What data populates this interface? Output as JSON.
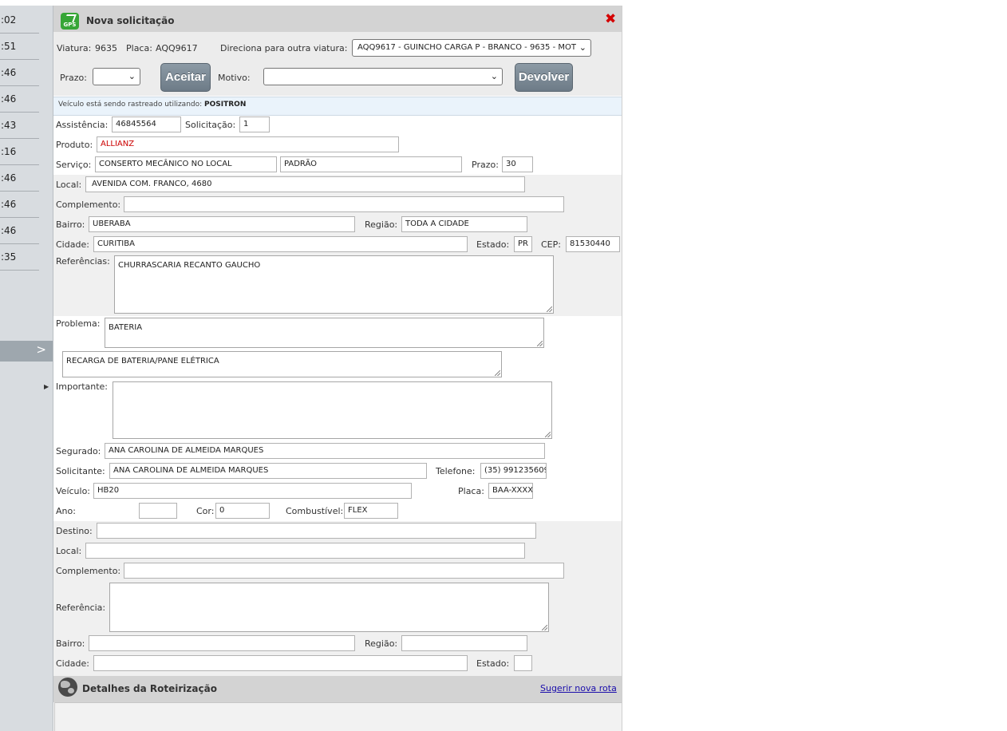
{
  "left_panel": {
    "times": [
      ":02",
      ":51",
      ":46",
      ":46",
      ":43",
      ":16",
      ":46",
      ":46",
      ":46",
      ":35"
    ],
    "collapse_icon": "chevron-right-icon",
    "expand_icon": "triangle-right-icon"
  },
  "modal": {
    "title": "Nova solicitação",
    "logo_text": "GPS",
    "close_icon": "close-icon",
    "toolbar": {
      "viatura_label": "Viatura:",
      "viatura_value": "9635",
      "placa_label": "Placa:",
      "placa_value": "AQQ9617",
      "direciona_label": "Direciona para outra viatura:",
      "direciona_value": "AQQ9617 - GUINCHO CARGA P - BRANCO - 9635 - MOT",
      "prazo_label": "Prazo:",
      "prazo_value": "",
      "aceitar_label": "Aceitar",
      "motivo_label": "Motivo:",
      "motivo_value": "",
      "devolver_label": "Devolver"
    },
    "tracking": {
      "prefix": "Veículo está sendo rastreado utilizando:",
      "provider": "POSITRON"
    },
    "form": {
      "assistencia_label": "Assistência:",
      "assistencia_value": "46845564",
      "solicitacao_label": "Solicitação:",
      "solicitacao_value": "1",
      "produto_label": "Produto:",
      "produto_value": "ALLIANZ",
      "servico_label": "Serviço:",
      "servico_value": "CONSERTO MECÂNICO NO LOCAL",
      "servico_tipo_value": "PADRÃO",
      "servico_prazo_label": "Prazo:",
      "servico_prazo_value": "30",
      "local_label": "Local:",
      "local_value": "AVENIDA COM. FRANCO, 4680",
      "complemento_label": "Complemento:",
      "complemento_value": "",
      "bairro_label": "Bairro:",
      "bairro_value": "UBERABA",
      "regiao_label": "Região:",
      "regiao_value": "TODA A CIDADE",
      "cidade_label": "Cidade:",
      "cidade_value": "CURITIBA",
      "estado_label": "Estado:",
      "estado_value": "PR",
      "cep_label": "CEP:",
      "cep_value": "81530440",
      "referencias_label": "Referências:",
      "referencias_value": "CHURRASCARIA RECANTO GAUCHO",
      "problema_label": "Problema:",
      "problema_value": "BATERIA",
      "problema_detalhe_value": "RECARGA DE BATERIA/PANE ELÉTRICA",
      "importante_label": "Importante:",
      "importante_value": "",
      "segurado_label": "Segurado:",
      "segurado_value": "ANA CAROLINA DE ALMEIDA MARQUES",
      "solicitante_label": "Solicitante:",
      "solicitante_value": "ANA CAROLINA DE ALMEIDA MARQUES",
      "telefone_label": "Telefone:",
      "telefone_value": "(35) 991235609",
      "veiculo_label": "Veículo:",
      "veiculo_value": "HB20",
      "placa_label": "Placa:",
      "placa_value": "BAA-XXXX",
      "ano_label": "Ano:",
      "ano_value": "",
      "cor_label": "Cor:",
      "cor_value": "0",
      "combustivel_label": "Combustível:",
      "combustivel_value": "FLEX"
    },
    "destino": {
      "destino_label": "Destino:",
      "destino_value": "",
      "local_label": "Local:",
      "local_value": "",
      "complemento_label": "Complemento:",
      "complemento_value": "",
      "referencia_label": "Referência:",
      "referencia_value": "",
      "bairro_label": "Bairro:",
      "bairro_value": "",
      "regiao_label": "Região:",
      "regiao_value": "",
      "cidade_label": "Cidade:",
      "cidade_value": "",
      "estado_label": "Estado:",
      "estado_value": ""
    },
    "route": {
      "title": "Detalhes da Roteirização",
      "suggest_link": "Sugerir nova rota",
      "icon": "globe-icon"
    }
  },
  "colors": {
    "header_gray": "#d3d3d3",
    "close_red": "#d40000",
    "produto_red": "#cc0000",
    "button_slate": "#7a8894",
    "link_blue": "#1a0dab"
  }
}
